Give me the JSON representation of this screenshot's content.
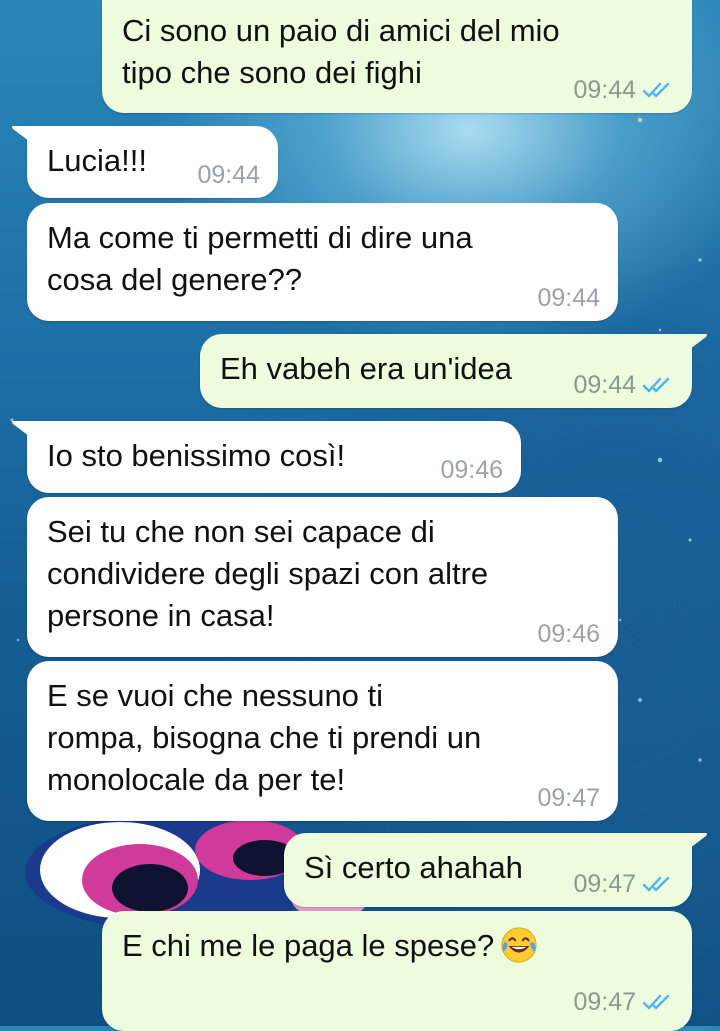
{
  "messages": [
    {
      "id": 1,
      "direction": "out",
      "text": "Ci sono un paio di amici del mio\ntipo che sono dei fighi",
      "time": "09:44",
      "status": "read"
    },
    {
      "id": 2,
      "direction": "in",
      "text": "Lucia!!!",
      "time": "09:44"
    },
    {
      "id": 3,
      "direction": "in",
      "text": "Ma come ti permetti di dire una\ncosa del genere??",
      "time": "09:44"
    },
    {
      "id": 4,
      "direction": "out",
      "text": "Eh vabeh era un'idea",
      "time": "09:44",
      "status": "read"
    },
    {
      "id": 5,
      "direction": "in",
      "text": "Io sto benissimo così!",
      "time": "09:46"
    },
    {
      "id": 6,
      "direction": "in",
      "text": "Sei tu che non sei capace di\ncondividere degli spazi con altre\npersone in casa!",
      "time": "09:46"
    },
    {
      "id": 7,
      "direction": "in",
      "text": "E se vuoi che nessuno ti\nrompa, bisogna che ti prendi un\nmonolocale da per te!",
      "time": "09:47"
    },
    {
      "id": 8,
      "direction": "out",
      "text": "Sì certo ahahah",
      "time": "09:47",
      "status": "read"
    },
    {
      "id": 9,
      "direction": "out",
      "text": "E chi me le paga le spese?",
      "time": "09:47",
      "status": "read",
      "emoji": "face-with-tears-of-joy"
    }
  ],
  "colors": {
    "outgoing_bubble": "#ecfcdd",
    "incoming_bubble": "#ffffff",
    "read_ticks": "#4fb3f6",
    "timestamp": "#8a9a90"
  },
  "icons": {
    "read_receipt": "double-check-icon",
    "emoji": "laughing-emoji-icon"
  }
}
